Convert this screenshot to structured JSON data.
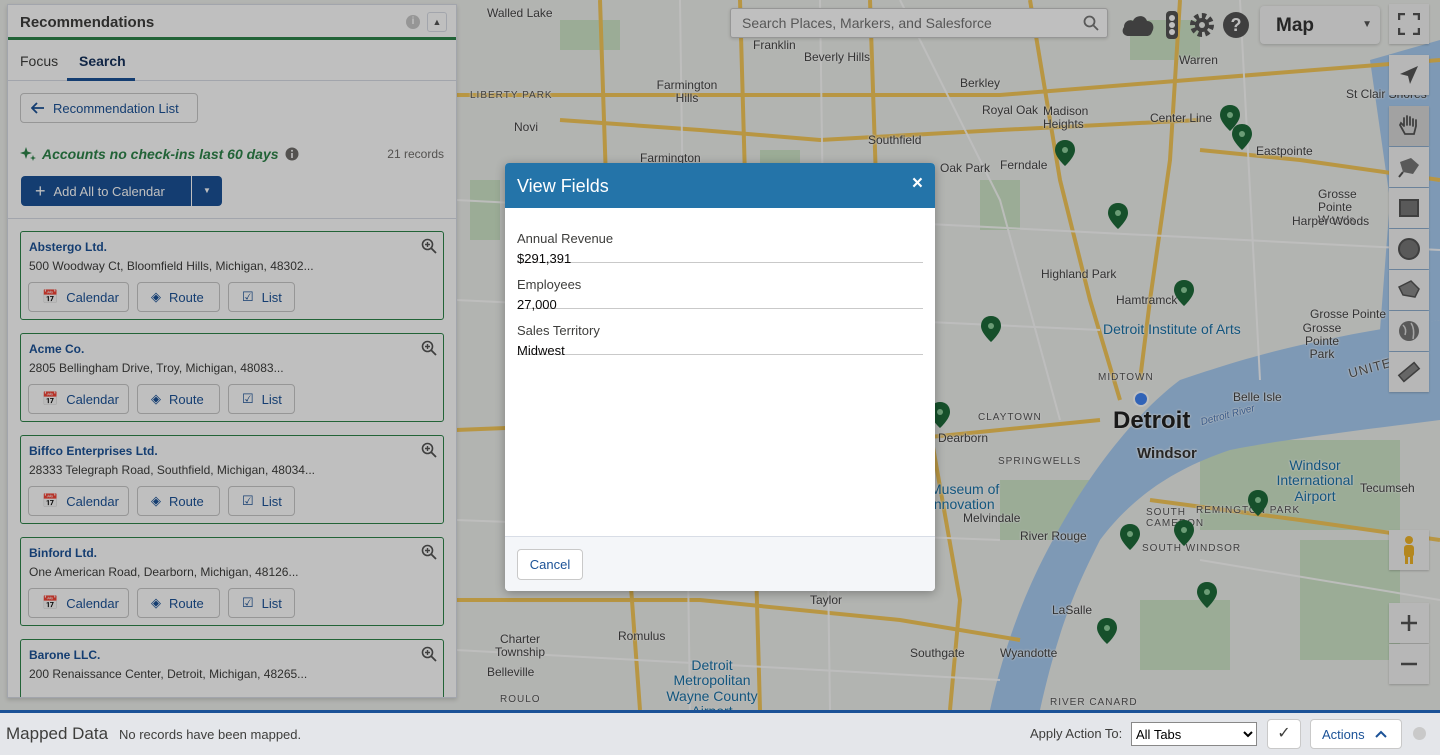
{
  "search": {
    "placeholder": "Search Places, Markers, and Salesforce"
  },
  "map_type": {
    "selected": "Map"
  },
  "map_labels": [
    {
      "text": "Walled Lake",
      "cls": ""
    },
    {
      "text": "Franklin",
      "cls": ""
    },
    {
      "text": "Beverly Hills",
      "cls": ""
    },
    {
      "text": "Warren",
      "cls": ""
    },
    {
      "text": "Berkley",
      "cls": ""
    },
    {
      "text": "Farmington Hills",
      "cls": ""
    },
    {
      "text": "Royal Oak",
      "cls": ""
    },
    {
      "text": "Madison Heights",
      "cls": ""
    },
    {
      "text": "Center Line",
      "cls": ""
    },
    {
      "text": "St Clair Shores",
      "cls": ""
    },
    {
      "text": "Novi",
      "cls": ""
    },
    {
      "text": "Southfield",
      "cls": ""
    },
    {
      "text": "Eastpointe",
      "cls": ""
    },
    {
      "text": "Farmington",
      "cls": ""
    },
    {
      "text": "Oak Park",
      "cls": ""
    },
    {
      "text": "Ferndale",
      "cls": ""
    },
    {
      "text": "Grosse Pointe Woods",
      "cls": ""
    },
    {
      "text": "Harper Woods",
      "cls": ""
    },
    {
      "text": "Highland Park",
      "cls": ""
    },
    {
      "text": "Hamtramck",
      "cls": ""
    },
    {
      "text": "Grosse Pointe",
      "cls": ""
    },
    {
      "text": "Grosse Pointe Park",
      "cls": ""
    },
    {
      "text": "Detroit Institute of Arts",
      "cls": "blue"
    },
    {
      "text": "MIDTOWN",
      "cls": "small-caps"
    },
    {
      "text": "Detroit",
      "cls": "big"
    },
    {
      "text": "Windsor",
      "cls": "mid"
    },
    {
      "text": "Belle Isle",
      "cls": ""
    },
    {
      "text": "CLAYTOWN",
      "cls": "small-caps"
    },
    {
      "text": "Dearborn",
      "cls": ""
    },
    {
      "text": "SPRINGWELLS",
      "cls": "small-caps"
    },
    {
      "text": "Museum of Innovation",
      "cls": "blue"
    },
    {
      "text": "Melvindale",
      "cls": ""
    },
    {
      "text": "Windsor International Airport",
      "cls": "blue"
    },
    {
      "text": "Tecumseh",
      "cls": ""
    },
    {
      "text": "SOUTH CAMERON",
      "cls": "small-caps"
    },
    {
      "text": "REMINGTON PARK",
      "cls": "small-caps"
    },
    {
      "text": "SOUTH WINDSOR",
      "cls": "small-caps"
    },
    {
      "text": "River Rouge",
      "cls": ""
    },
    {
      "text": "Taylor",
      "cls": ""
    },
    {
      "text": "Romulus",
      "cls": ""
    },
    {
      "text": "Detroit Metropolitan Wayne County Airport",
      "cls": "blue"
    },
    {
      "text": "LaSalle",
      "cls": ""
    },
    {
      "text": "Southgate",
      "cls": ""
    },
    {
      "text": "Wyandotte",
      "cls": ""
    },
    {
      "text": "Charter Township",
      "cls": ""
    },
    {
      "text": "Belleville",
      "cls": ""
    },
    {
      "text": "LIBERTY PARK",
      "cls": "small-caps"
    },
    {
      "text": "RIVER CANARD",
      "cls": "small-caps"
    },
    {
      "text": "ROULO",
      "cls": "small-caps"
    },
    {
      "text": "Detroit River",
      "cls": "water"
    },
    {
      "text": "UNITED",
      "cls": "small-caps"
    }
  ],
  "panel": {
    "title": "Recommendations",
    "tabs": [
      {
        "label": "Focus"
      },
      {
        "label": "Search"
      }
    ],
    "back_label": "Recommendation List",
    "section_title": "Accounts no check-ins last 60 days",
    "records": "21 records",
    "add_label": "Add All to Calendar",
    "btn_calendar": "Calendar",
    "btn_route": "Route",
    "btn_list": "List",
    "cards": [
      {
        "name": "Abstergo Ltd.",
        "address": "500 Woodway Ct, Bloomfield Hills, Michigan, 48302..."
      },
      {
        "name": "Acme Co.",
        "address": "2805 Bellingham Drive, Troy, Michigan, 48083..."
      },
      {
        "name": "Biffco Enterprises Ltd.",
        "address": "28333 Telegraph Road, Southfield, Michigan, 48034..."
      },
      {
        "name": "Binford Ltd.",
        "address": "One American Road, Dearborn, Michigan, 48126..."
      },
      {
        "name": "Barone LLC.",
        "address": "200 Renaissance Center, Detroit, Michigan, 48265..."
      }
    ]
  },
  "modal": {
    "title": "View Fields",
    "close": "×",
    "fields": [
      {
        "label": "Annual Revenue",
        "value": "$291,391"
      },
      {
        "label": "Employees",
        "value": "27,000"
      },
      {
        "label": "Sales Territory",
        "value": "Midwest"
      }
    ],
    "cancel": "Cancel"
  },
  "bottom": {
    "title": "Mapped Data",
    "note": "No records have been mapped.",
    "apply_label": "Apply Action To:",
    "apply_value": "All Tabs",
    "actions": "Actions"
  },
  "colors": {
    "brand": "#1b5297",
    "accent_green": "#2e844a",
    "modal_header": "#2474a9"
  }
}
